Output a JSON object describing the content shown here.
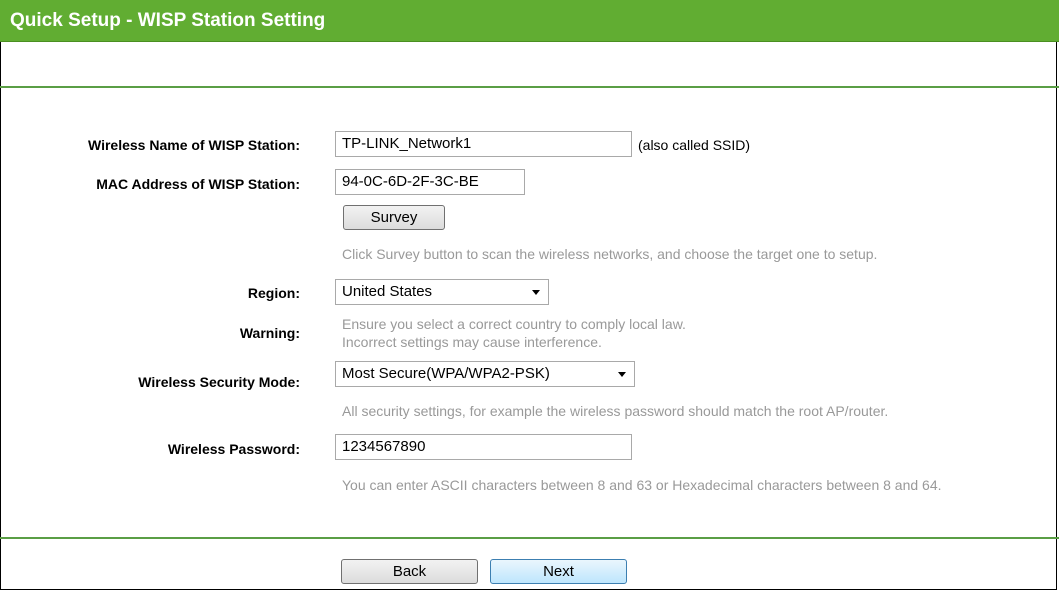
{
  "header": {
    "title": "Quick Setup - WISP Station Setting"
  },
  "form": {
    "ssid": {
      "label": "Wireless Name of WISP Station:",
      "value": "TP-LINK_Network1",
      "note": "(also called SSID)"
    },
    "mac": {
      "label": "MAC Address of WISP Station:",
      "value": "94-0C-6D-2F-3C-BE"
    },
    "survey": {
      "button": "Survey",
      "hint": "Click Survey button to scan the wireless networks, and choose the target one to setup."
    },
    "region": {
      "label": "Region:",
      "value": "United States"
    },
    "warning": {
      "label": "Warning:",
      "line1": "Ensure you select a correct country to comply local law.",
      "line2": "Incorrect settings may cause interference."
    },
    "security": {
      "label": "Wireless Security Mode:",
      "value": "Most Secure(WPA/WPA2-PSK)",
      "hint": "All security settings, for example the wireless password should match the root AP/router."
    },
    "password": {
      "label": "Wireless Password:",
      "value": "1234567890",
      "hint": "You can enter ASCII characters between 8 and 63 or Hexadecimal characters between 8 and 64."
    }
  },
  "footer": {
    "back": "Back",
    "next": "Next"
  }
}
